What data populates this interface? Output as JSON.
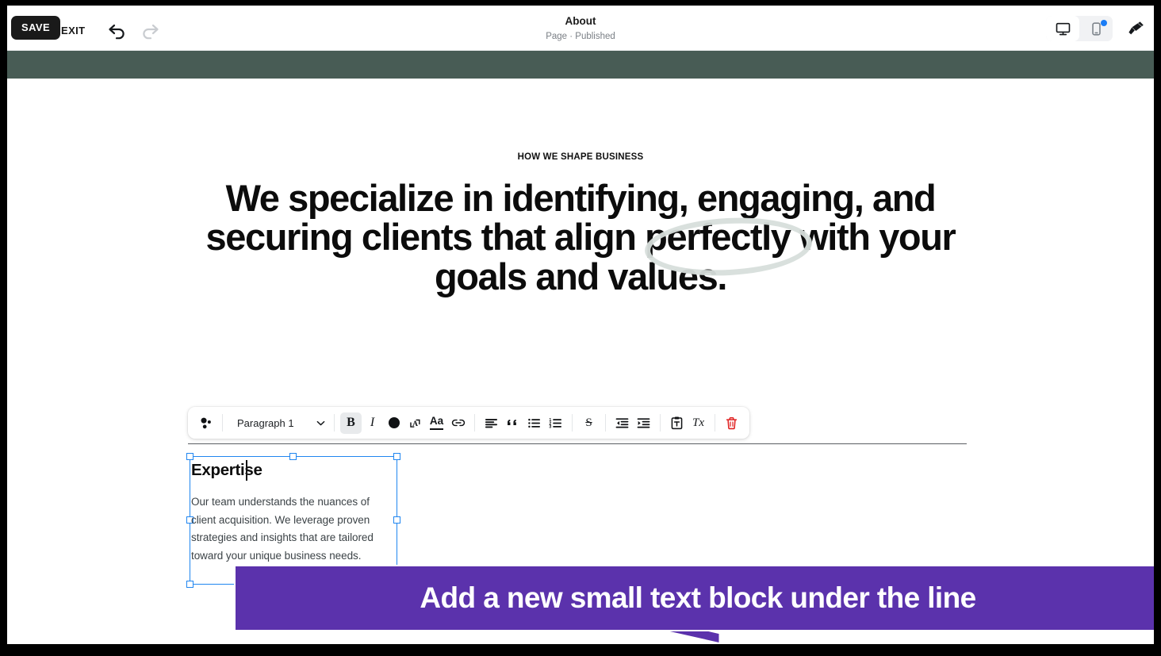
{
  "topbar": {
    "save_label": "SAVE",
    "exit_label": "EXIT",
    "undo_icon": "undo-arrow-icon",
    "redo_icon": "redo-arrow-icon",
    "title": "About",
    "subtitle": "Page · Published",
    "viewport": {
      "desktop_icon": "desktop-monitor-icon",
      "mobile_icon": "mobile-phone-icon",
      "selected": "desktop",
      "mobile_has_notification": true,
      "notification_color": "#1b7df5"
    },
    "brush_icon": "paint-brush-icon"
  },
  "site": {
    "band_color": "#485c55"
  },
  "page": {
    "eyebrow": "HOW WE SHAPE BUSINESS",
    "headline": "We specialize in identifying, engaging, and securing clients that align perfectly with your goals and values.",
    "highlight_word": "perfectly",
    "highlight_color": "#d7dedb"
  },
  "toolbar": {
    "style_icon": "color-dots-icon",
    "style_value": "Paragraph 1",
    "chevron_icon": "chevron-down-icon",
    "buttons": [
      {
        "name": "bold-button",
        "label": "B",
        "icon": "bold-icon",
        "active": true
      },
      {
        "name": "italic-button",
        "label": "I",
        "icon": "italic-icon",
        "active": false
      },
      {
        "name": "text-color-button",
        "label": "",
        "icon": "filled-circle-icon",
        "active": false
      },
      {
        "name": "font-size-button",
        "label": "",
        "icon": "font-size-icon",
        "active": false
      },
      {
        "name": "text-case-button",
        "label": "Aa",
        "icon": "text-case-icon",
        "active": false
      },
      {
        "name": "link-button",
        "label": "",
        "icon": "link-chain-icon",
        "active": false
      },
      {
        "name": "align-button",
        "label": "",
        "icon": "align-left-icon",
        "active": false
      },
      {
        "name": "blockquote-button",
        "label": "““",
        "icon": "quote-icon",
        "active": false
      },
      {
        "name": "bulleted-list-button",
        "label": "",
        "icon": "bulleted-list-icon",
        "active": false
      },
      {
        "name": "numbered-list-button",
        "label": "",
        "icon": "numbered-list-icon",
        "active": false
      },
      {
        "name": "strikethrough-button",
        "label": "S",
        "icon": "strikethrough-icon",
        "active": false
      },
      {
        "name": "outdent-button",
        "label": "",
        "icon": "outdent-icon",
        "active": false
      },
      {
        "name": "indent-button",
        "label": "",
        "icon": "indent-icon",
        "active": false
      },
      {
        "name": "paste-as-text-button",
        "label": "",
        "icon": "clipboard-text-icon",
        "active": false
      },
      {
        "name": "clear-format-button",
        "label": "Tx",
        "icon": "clear-formatting-icon",
        "active": false
      },
      {
        "name": "delete-button",
        "label": "",
        "icon": "trash-icon",
        "active": false
      }
    ],
    "delete_color": "#e02020"
  },
  "text_block": {
    "heading": "Expertise",
    "body": "Our team understands the nuances of client acquisition. We leverage proven strategies and insights that are tailored toward your unique business needs.",
    "selected": true,
    "selection_color": "#2086f0",
    "caret_visible": true
  },
  "annotation": {
    "callout_text": "Add a new small text block under the line",
    "color": "#5b32ac",
    "arrow_icon": "arrow-pointer-icon"
  }
}
